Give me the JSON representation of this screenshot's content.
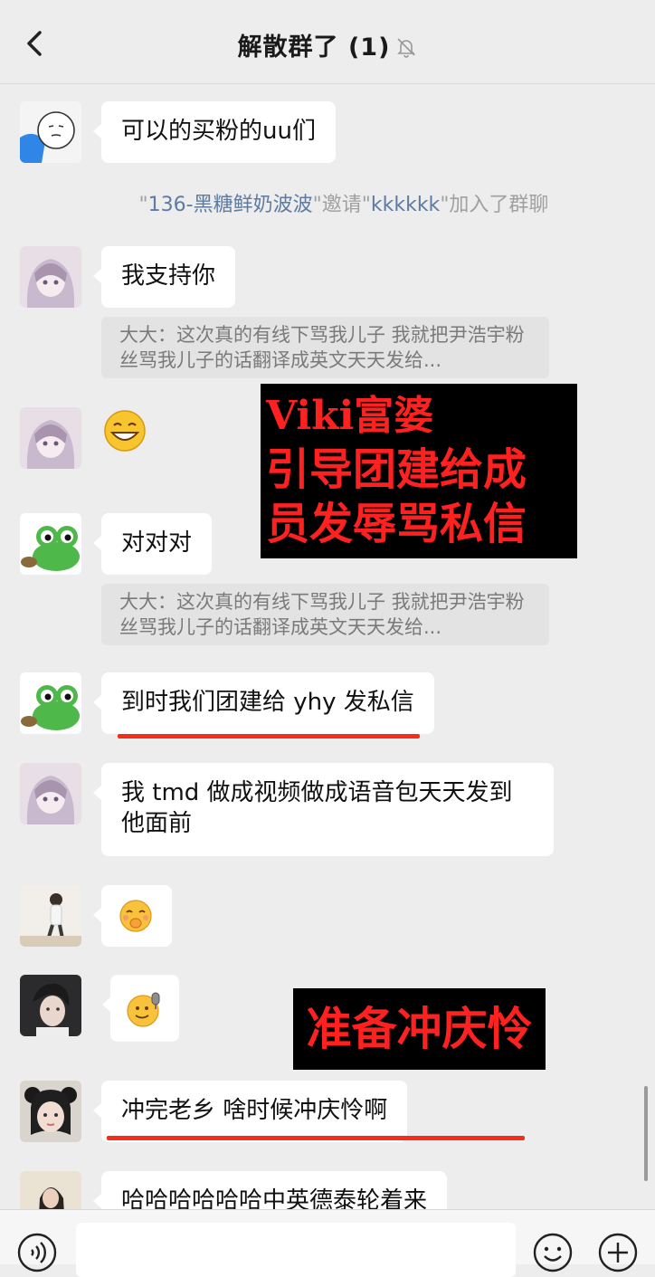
{
  "header": {
    "title": "解散群了 (1)"
  },
  "system_message": {
    "quote_open": "\"",
    "inviter": "136-黑糖鲜奶波波",
    "mid": "\"邀请\"",
    "invitee": "kkkkkk",
    "tail": "\"加入了群聊"
  },
  "messages": [
    {
      "text": "可以的买粉的uu们"
    },
    {
      "text": "我支持你",
      "quote": "大大：这次真的有线下骂我儿子 我就把尹浩宇粉丝骂我儿子的话翻译成英文天天发给..."
    },
    {
      "emoji": "grinning-emoji"
    },
    {
      "text": "对对对",
      "quote": "大大：这次真的有线下骂我儿子 我就把尹浩宇粉丝骂我儿子的话翻译成英文天天发给..."
    },
    {
      "text": "到时我们团建给 yhy 发私信"
    },
    {
      "text": "我 tmd 做成视频做成语音包天天发到他面前"
    },
    {
      "emoji": "shushing-emoji"
    },
    {
      "emoji": "microphone-emoji"
    },
    {
      "text": "冲完老乡 啥时候冲庆怜啊"
    },
    {
      "text": "哈哈哈哈哈哈中英德泰轮着来"
    }
  ],
  "overlays": {
    "first": [
      "Viki富婆",
      "引导团建给成",
      "员发辱骂私信"
    ],
    "second": "准备冲庆怜"
  },
  "colors": {
    "overlay_text": "#ff2020",
    "underline": "#f72d1c",
    "link_blue": "#5d7ba3"
  }
}
